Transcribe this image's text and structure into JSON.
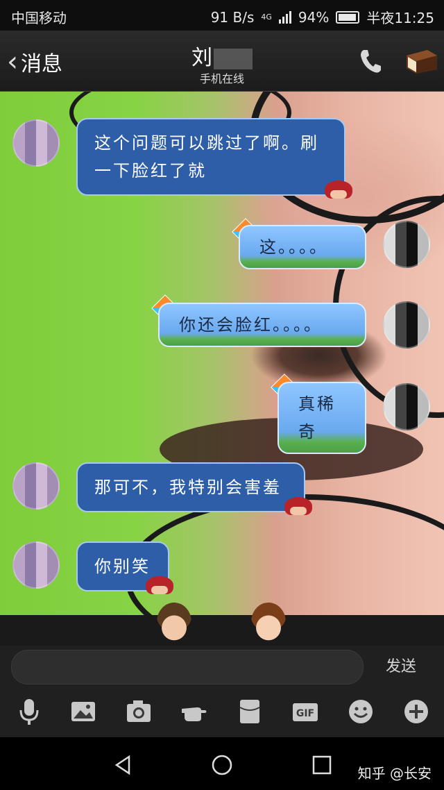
{
  "status_bar": {
    "carrier": "中国移动",
    "speed": "91 B/s",
    "network": "4G",
    "battery": "94%",
    "time": "半夜11:25"
  },
  "header": {
    "back_label": "消息",
    "contact_name": "刘",
    "status": "手机在线"
  },
  "messages": [
    {
      "side": "left",
      "text": "这个问题可以跳过了啊。刷一下脸红了就"
    },
    {
      "side": "right",
      "text": "这。。。。"
    },
    {
      "side": "right",
      "text": "你还会脸红。。。。"
    },
    {
      "side": "right",
      "text": "真稀奇"
    },
    {
      "side": "left",
      "text": "那可不，我特别会害羞"
    },
    {
      "side": "left",
      "text": "你别笑"
    }
  ],
  "input": {
    "placeholder": "",
    "send_label": "发送"
  },
  "toolbar": [
    "mic-icon",
    "image-icon",
    "camera-icon",
    "poke-icon",
    "red-packet-icon",
    "gif-icon",
    "emoji-icon",
    "plus-icon"
  ],
  "watermark": "知乎 @长安"
}
